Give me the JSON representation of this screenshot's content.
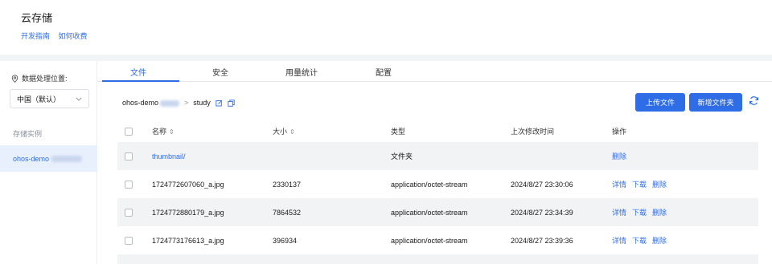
{
  "header": {
    "title": "云存储",
    "links": [
      "开发指南",
      "如何收费"
    ]
  },
  "sidebar": {
    "region_label": "数据处理位置:",
    "region_value": "中国（默认）",
    "instances_label": "存储实例",
    "instance_name": "ohos-demo"
  },
  "tabs": [
    "文件",
    "安全",
    "用量统计",
    "配置"
  ],
  "breadcrumb": {
    "root": "ohos-demo",
    "separator": ">",
    "current": "study"
  },
  "actions": {
    "upload": "上传文件",
    "new_folder": "新增文件夹"
  },
  "table": {
    "columns": [
      "名称",
      "大小",
      "类型",
      "上次修改时间",
      "操作"
    ],
    "rows": [
      {
        "name": "thumbnail/",
        "size": "",
        "type": "文件夹",
        "modified": "",
        "ops": [
          "删除"
        ]
      },
      {
        "name": "1724772607060_a.jpg",
        "size": "2330137",
        "type": "application/octet-stream",
        "modified": "2024/8/27 23:30:06",
        "ops": [
          "详情",
          "下载",
          "删除"
        ]
      },
      {
        "name": "1724772880179_a.jpg",
        "size": "7864532",
        "type": "application/octet-stream",
        "modified": "2024/8/27 23:34:39",
        "ops": [
          "详情",
          "下载",
          "删除"
        ]
      },
      {
        "name": "1724773176613_a.jpg",
        "size": "396934",
        "type": "application/octet-stream",
        "modified": "2024/8/27 23:39:36",
        "ops": [
          "详情",
          "下载",
          "删除"
        ]
      }
    ]
  },
  "colors": {
    "accent": "#2f6de6",
    "background": "#f1f3f5"
  }
}
